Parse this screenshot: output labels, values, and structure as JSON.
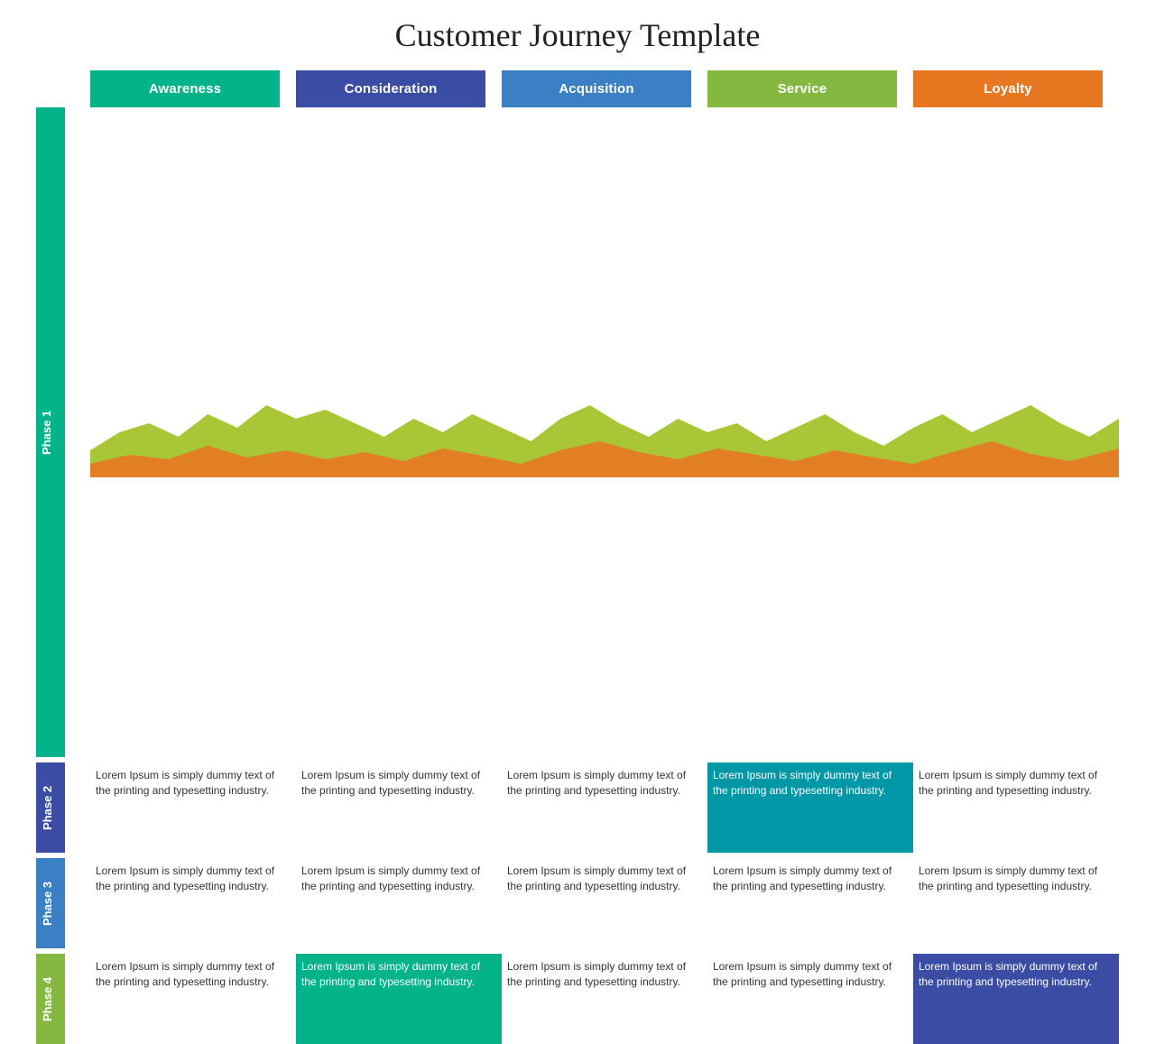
{
  "title": "Customer Journey Template",
  "columns": [
    {
      "label": "Awareness",
      "class": "col-awareness"
    },
    {
      "label": "Consideration",
      "class": "col-consideration"
    },
    {
      "label": "Acquisition",
      "class": "col-acquisition"
    },
    {
      "label": "Service",
      "class": "col-service"
    },
    {
      "label": "Loyalty",
      "class": "col-loyalty"
    }
  ],
  "phases": [
    {
      "label": "Phase 1",
      "sidebarClass": "phase1-sidebar"
    },
    {
      "label": "Phase 2",
      "sidebarClass": "phase2-sidebar"
    },
    {
      "label": "Phase 3",
      "sidebarClass": "phase3-sidebar"
    },
    {
      "label": "Phase 4",
      "sidebarClass": "phase4-sidebar"
    }
  ],
  "lorem": "Lorem Ipsum is simply dummy text of the printing and typesetting industry.",
  "highlighted": {
    "phase2_service": true,
    "phase4_consideration": true,
    "phase4_loyalty": true
  }
}
